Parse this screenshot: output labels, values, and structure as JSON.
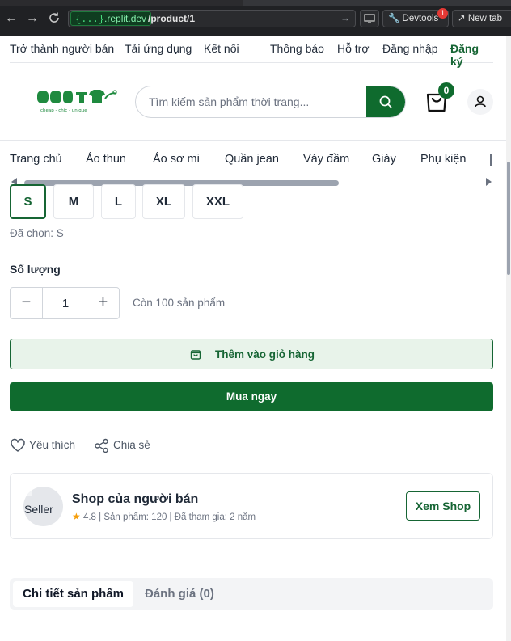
{
  "browser": {
    "url_host": "{...}",
    "url_host_rest": ".replit.dev",
    "url_path": "/product/1",
    "devtools_label": "Devtools",
    "devtools_badge": "1",
    "new_tab_label": "New tab"
  },
  "topbar": {
    "become_seller": "Trở thành người bán",
    "download_app": "Tải ứng dụng",
    "connect": "Kết nối",
    "notifications": "Thông báo",
    "support": "Hỗ trợ",
    "login": "Đăng nhập",
    "register": "Đăng ký"
  },
  "header": {
    "logo_tagline": "cheap - chic - unique",
    "search_placeholder": "Tìm kiếm sản phẩm thời trang...",
    "cart_count": "0"
  },
  "categories": [
    "Trang chủ",
    "Áo thun",
    "Áo sơ mi",
    "Quần jean",
    "Váy đầm",
    "Giày",
    "Phụ kiện"
  ],
  "product": {
    "sizes": [
      "S",
      "M",
      "L",
      "XL",
      "XXL"
    ],
    "selected_size_label": "Đã chọn: S",
    "quantity_label": "Số lượng",
    "quantity_value": "1",
    "minus": "−",
    "plus": "+",
    "stock_text": "Còn 100 sản phẩm",
    "add_to_cart": "Thêm vào giỏ hàng",
    "buy_now": "Mua ngay",
    "favorite": "Yêu thích",
    "share": "Chia sẻ"
  },
  "shop": {
    "avatar_alt": "Seller",
    "name": "Shop của người bán",
    "rating": "4.8",
    "meta": "| Sản phẩm: 120 | Đã tham gia: 2 năm",
    "view_shop": "Xem Shop"
  },
  "tabs": {
    "details": "Chi tiết sản phẩm",
    "reviews": "Đánh giá (0)"
  },
  "colors": {
    "brand_green": "#0f6b2e",
    "text_dark": "#1f2937",
    "muted": "#6b7280"
  }
}
